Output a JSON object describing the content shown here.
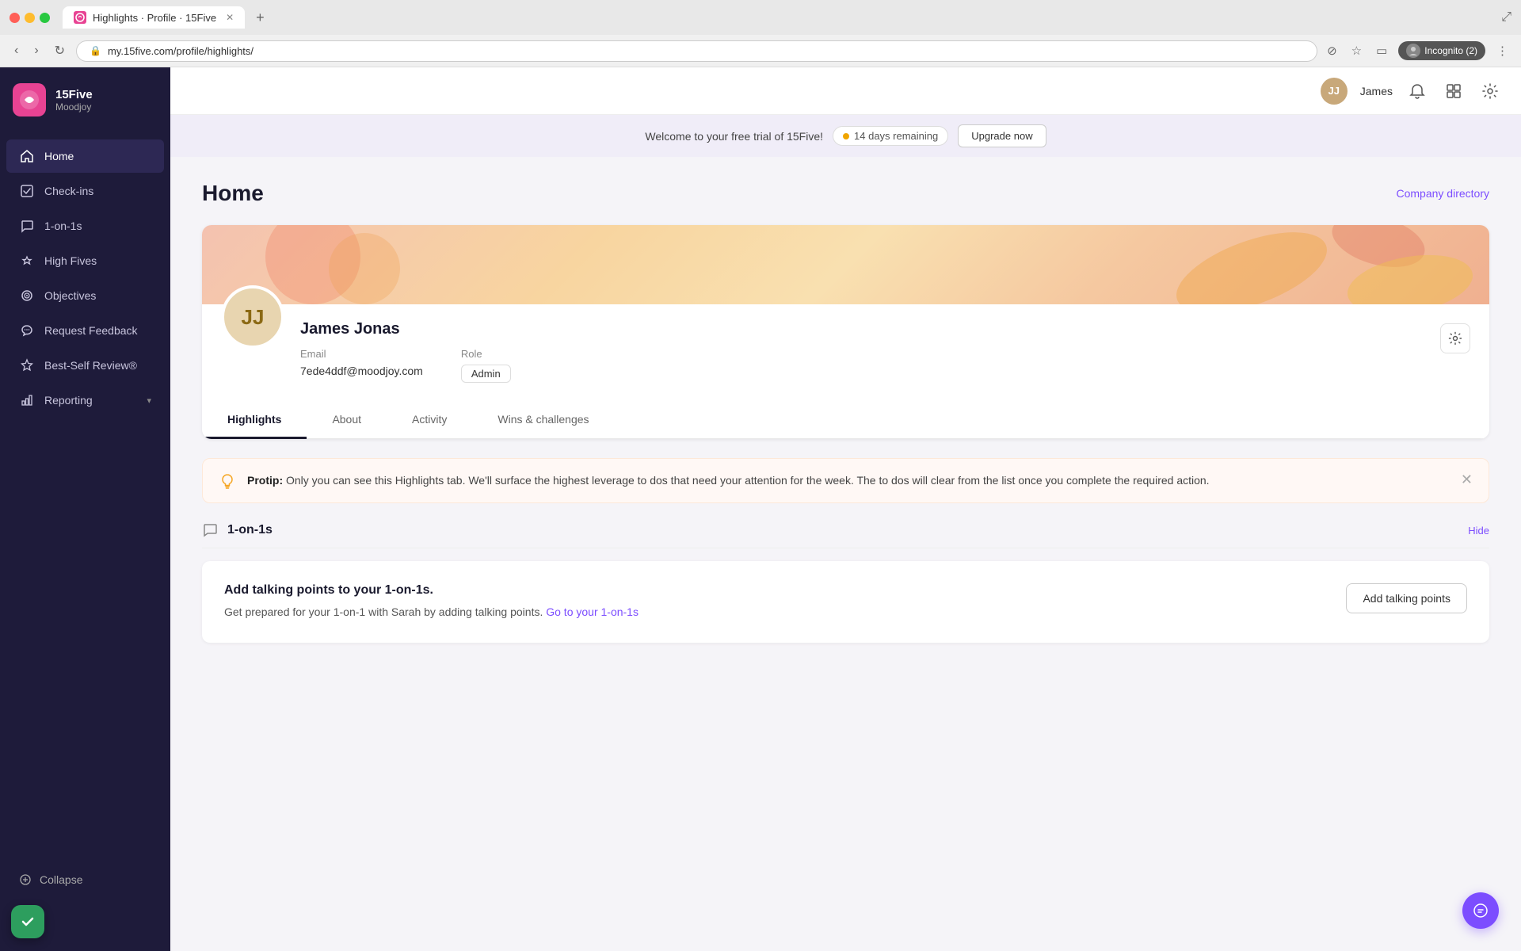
{
  "browser": {
    "tab_title": "Highlights · Profile · 15Five",
    "tab_favicon": "15",
    "url": "my.15five.com/profile/highlights/",
    "new_tab_label": "+",
    "incognito_label": "Incognito (2)"
  },
  "top_bar": {
    "user_initials": "JJ",
    "user_name": "James"
  },
  "trial_banner": {
    "welcome_text": "Welcome to your free trial of 15Five!",
    "days_remaining": "14 days remaining",
    "upgrade_label": "Upgrade now"
  },
  "sidebar": {
    "brand_name": "15Five",
    "brand_sub": "Moodjoy",
    "nav_items": [
      {
        "label": "Home",
        "icon": "home",
        "active": true
      },
      {
        "label": "Check-ins",
        "icon": "checkins",
        "active": false
      },
      {
        "label": "1-on-1s",
        "icon": "chat",
        "active": false
      },
      {
        "label": "High Fives",
        "icon": "highfive",
        "active": false
      },
      {
        "label": "Objectives",
        "icon": "objectives",
        "active": false
      },
      {
        "label": "Request Feedback",
        "icon": "feedback",
        "active": false
      },
      {
        "label": "Best-Self Review®",
        "icon": "review",
        "active": false
      },
      {
        "label": "Reporting",
        "icon": "reporting",
        "active": false,
        "has_chevron": true
      }
    ],
    "collapse_label": "Collapse"
  },
  "page": {
    "title": "Home",
    "company_directory_label": "Company directory"
  },
  "profile": {
    "avatar_initials": "JJ",
    "name": "James Jonas",
    "email_label": "Email",
    "email_value": "7ede4ddf@moodjoy.com",
    "role_label": "Role",
    "role_value": "Admin"
  },
  "tabs": [
    {
      "label": "Highlights",
      "active": true
    },
    {
      "label": "About",
      "active": false
    },
    {
      "label": "Activity",
      "active": false
    },
    {
      "label": "Wins & challenges",
      "active": false
    }
  ],
  "protip": {
    "prefix": "Protip:",
    "text": " Only you can see this Highlights tab. We'll surface the highest leverage to dos that need your attention for the week. The to dos will clear from the list once you complete the required action."
  },
  "one_on_one_section": {
    "title": "1-on-1s",
    "hide_label": "Hide",
    "card_title": "Add talking points to your 1-on-1s.",
    "card_text": "Get prepared for your 1-on-1 with Sarah by adding talking points.",
    "card_link_label": "Go to your 1-on-1s",
    "card_button_label": "Add talking points"
  }
}
